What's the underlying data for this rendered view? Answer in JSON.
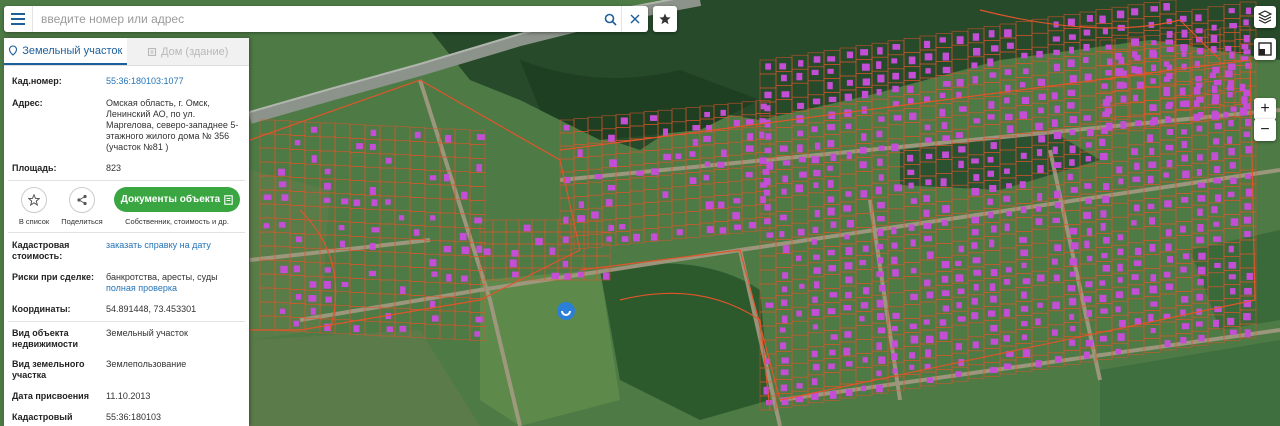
{
  "search": {
    "placeholder": "введите номер или адрес"
  },
  "tabs": [
    {
      "label": "Земельный участок",
      "active": true
    },
    {
      "label": "Дом (здание)",
      "active": false
    }
  ],
  "parcel": {
    "cad_number_label": "Кад.номер:",
    "cad_number": "55:36:180103:1077",
    "address_label": "Адрес:",
    "address": "Омская область, г. Омск, Ленинский АО, по ул. Маргелова, северо-западнее 5-этажного жилого дома № 356 (участок №81 )",
    "area_label": "Площадь:",
    "area": "823",
    "actions": {
      "favorite_label": "В список",
      "share_label": "Поделиться",
      "documents_label": "Документы объекта",
      "documents_sub": "Собственник, стоимость и др."
    },
    "cad_value_label": "Кадастровая стоимость:",
    "cad_value_link": "заказать справку на дату",
    "risks_label": "Риски при сделке:",
    "risks_text": "банкротства, аресты, суды",
    "risks_link": "полная проверка",
    "coords_label": "Координаты:",
    "coords": "54.891448, 73.453301",
    "object_type_label": "Вид объекта недвижимости",
    "object_type": "Земельный участок",
    "land_type_label": "Вид земельного участка",
    "land_type": "Землепользование",
    "date_label": "Дата присвоения",
    "date": "11.10.2013",
    "quarter_label": "Кадастровый квартал",
    "quarter": "55:36:180103"
  },
  "map": {
    "zoom_in": "+",
    "zoom_out": "−",
    "parcel_color": "#e0552a",
    "roof_color": "#c44fd6",
    "marker_color": "#2b7fd8"
  },
  "icons": {
    "menu": "menu-icon",
    "search": "search-icon",
    "clear": "close-icon",
    "star": "star-icon",
    "layers": "layers-icon",
    "fullscreen": "fullscreen-icon",
    "marker": "location-marker-icon"
  }
}
